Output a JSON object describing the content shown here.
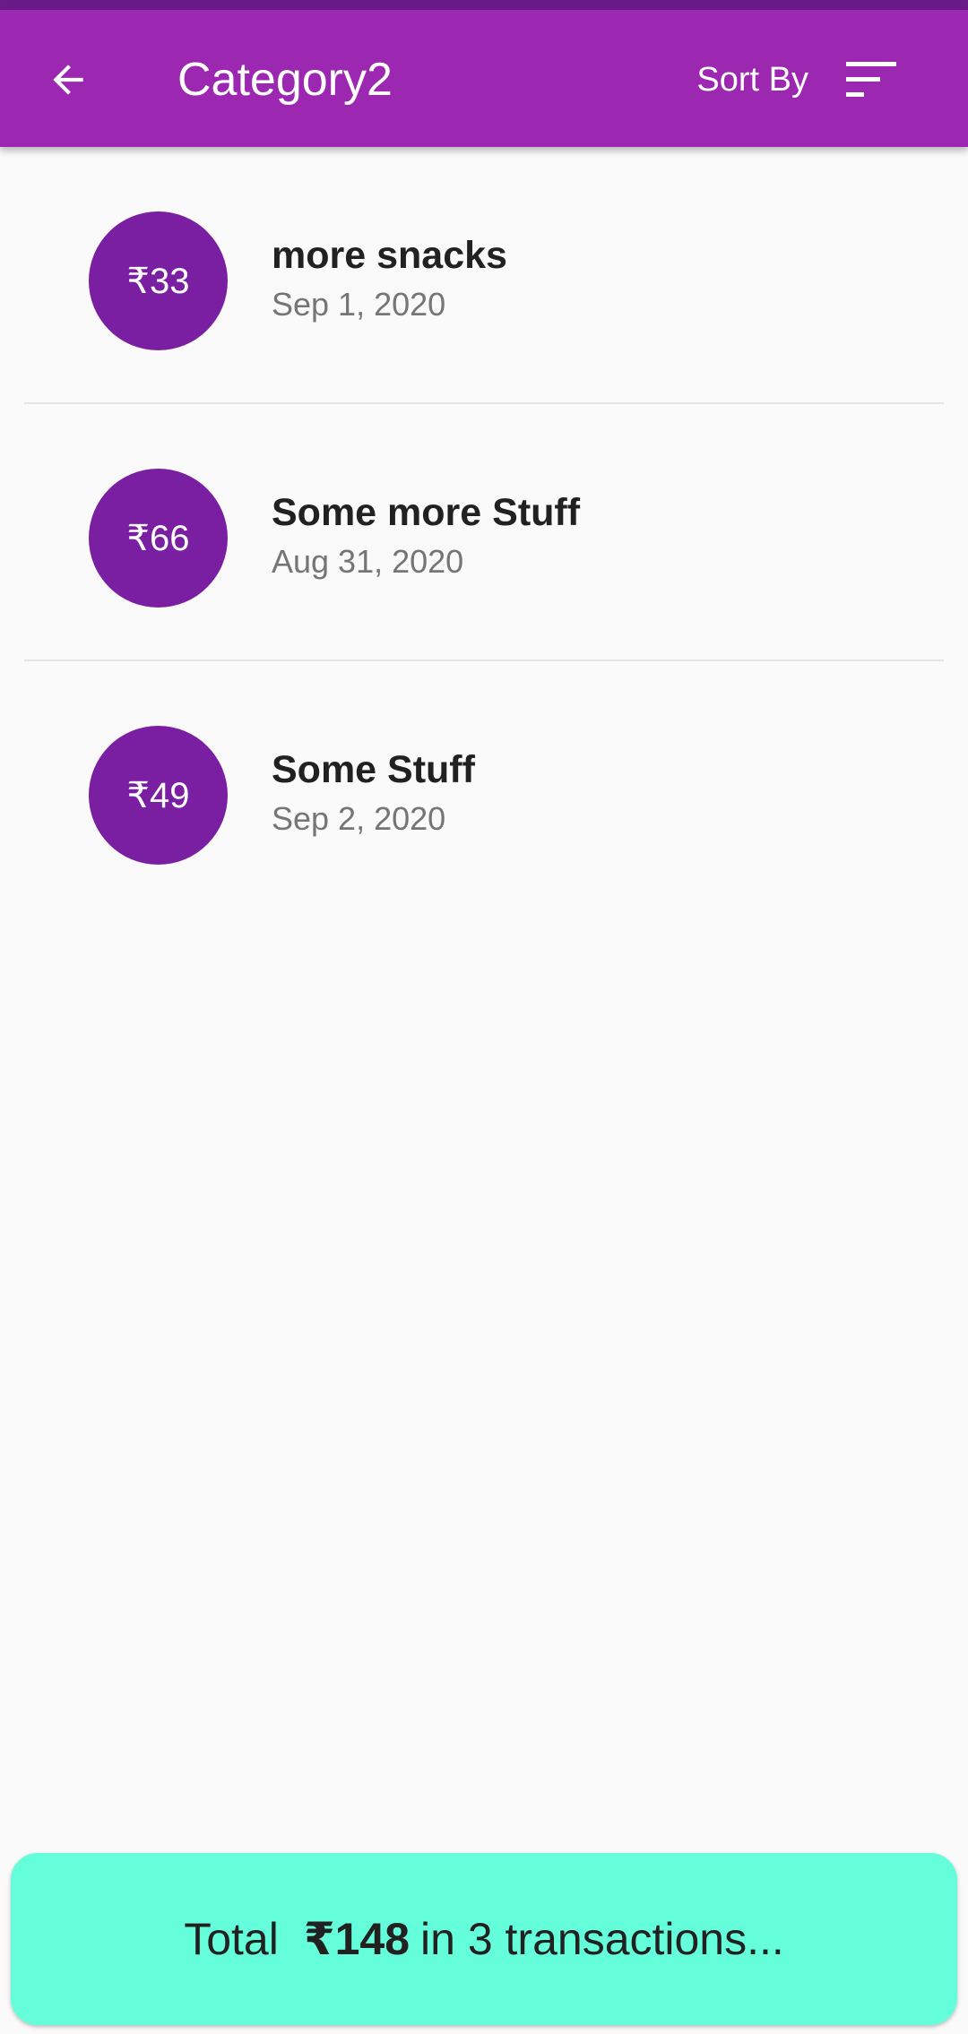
{
  "app_bar": {
    "title": "Category2",
    "sort_label": "Sort By",
    "color": "#9c27b0",
    "back_icon": "arrow-back-icon",
    "sort_icon": "sort-icon"
  },
  "transactions": [
    {
      "amount": "₹33",
      "title": "more snacks",
      "date": "Sep 1, 2020"
    },
    {
      "amount": "₹66",
      "title": "Some more Stuff",
      "date": "Aug 31, 2020"
    },
    {
      "amount": "₹49",
      "title": "Some Stuff",
      "date": "Sep 2, 2020"
    }
  ],
  "summary": {
    "prefix": "Total",
    "amount": "₹148",
    "suffix": "in 3 transactions...",
    "color": "#64ffda"
  }
}
